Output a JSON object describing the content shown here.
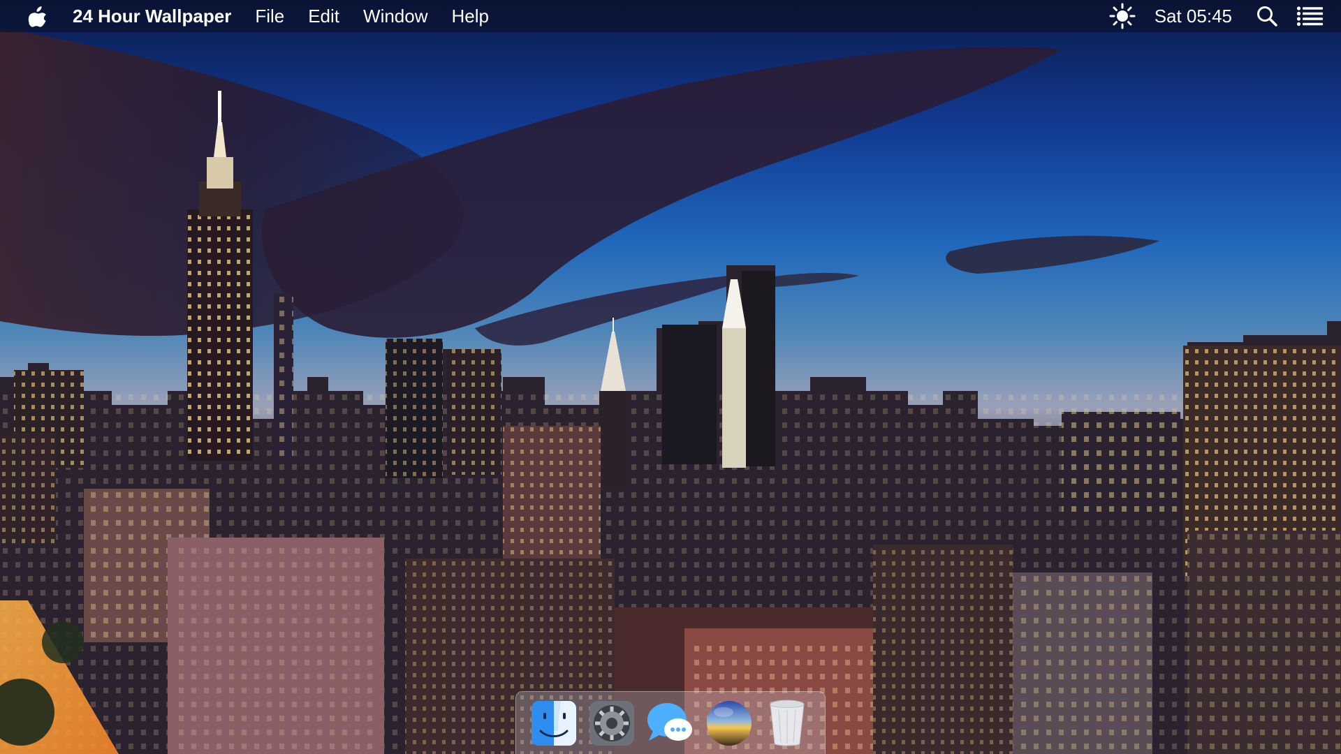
{
  "menubar": {
    "apple_icon": "apple-logo-icon",
    "app_name": "24 Hour Wallpaper",
    "menus": [
      "File",
      "Edit",
      "Window",
      "Help"
    ],
    "status": {
      "wallpaper_icon": "sun-icon",
      "clock": "Sat 05:45",
      "search_icon": "search-icon",
      "notification_icon": "list-icon"
    }
  },
  "dock": {
    "items": [
      {
        "name": "finder",
        "icon": "finder-icon"
      },
      {
        "name": "system-preferences",
        "icon": "gear-icon"
      },
      {
        "name": "messages",
        "icon": "chat-bubble-icon"
      },
      {
        "name": "24-hour-wallpaper",
        "icon": "sphere-icon"
      },
      {
        "name": "trash",
        "icon": "trash-icon"
      }
    ]
  },
  "colors": {
    "sky_top": "#0d1f57",
    "sky_mid": "#1d5fb3",
    "horizon": "#8a8fa8",
    "city_lights": "#ffcf6a",
    "menubar_bg": "#0a122c"
  }
}
